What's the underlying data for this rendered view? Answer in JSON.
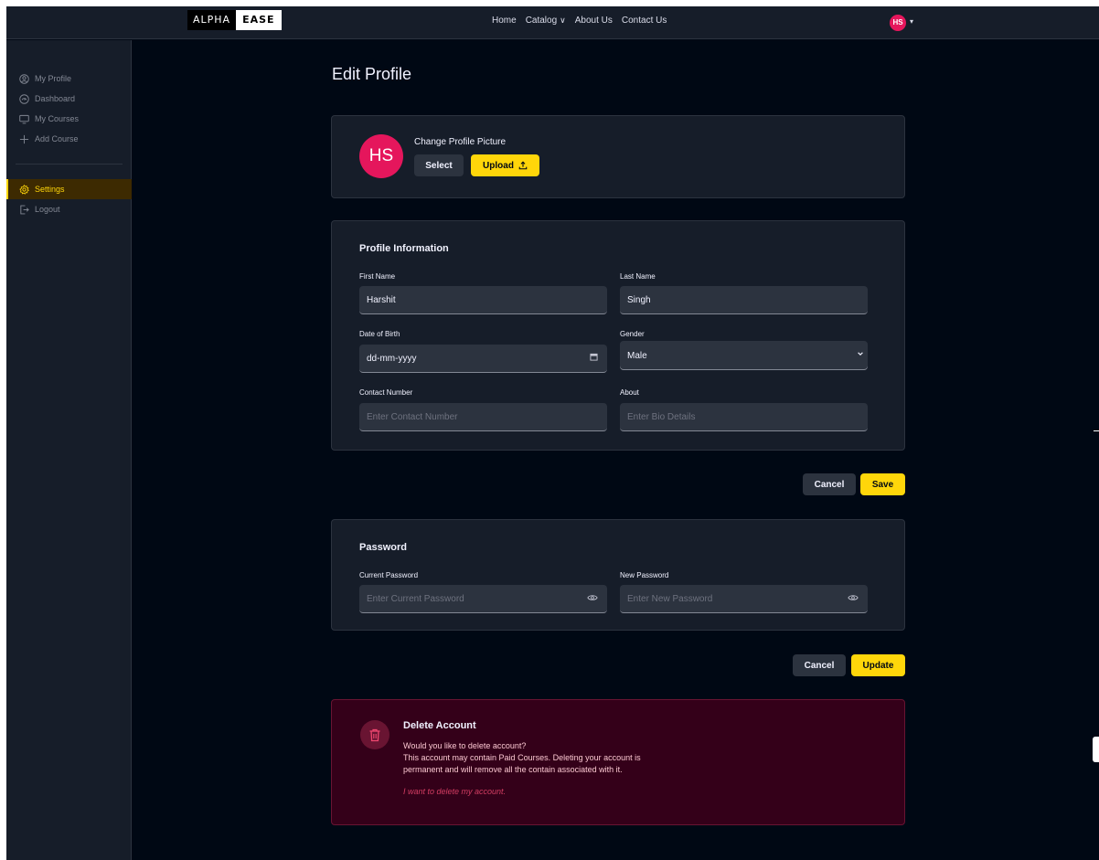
{
  "brand": {
    "part1": "ALPHA",
    "part2": "EASE"
  },
  "nav": {
    "links": [
      "Home",
      "Catalog",
      "About Us",
      "Contact Us"
    ],
    "catalog_chevron": "∨",
    "user_initials": "HS",
    "caret": "▾"
  },
  "sidebar": {
    "items": [
      {
        "label": "My Profile",
        "icon": "user-circle-icon"
      },
      {
        "label": "Dashboard",
        "icon": "dashboard-icon"
      },
      {
        "label": "My Courses",
        "icon": "monitor-icon"
      },
      {
        "label": "Add Course",
        "icon": "plus-icon"
      },
      {
        "label": "Settings",
        "icon": "gear-icon",
        "active": true
      },
      {
        "label": "Logout",
        "icon": "logout-icon"
      }
    ]
  },
  "page": {
    "title": "Edit Profile"
  },
  "picture": {
    "initials": "HS",
    "label": "Change Profile Picture",
    "select_label": "Select",
    "upload_label": "Upload",
    "upload_icon": "upload-icon"
  },
  "profile": {
    "title": "Profile Information",
    "first_name_label": "First Name",
    "first_name_value": "Harshit",
    "last_name_label": "Last Name",
    "last_name_value": "Singh",
    "dob_label": "Date of Birth",
    "dob_value": "dd-mm-yyyy",
    "gender_label": "Gender",
    "gender_value": "Male",
    "contact_label": "Contact Number",
    "contact_placeholder": "Enter Contact Number",
    "about_label": "About",
    "about_placeholder": "Enter Bio Details",
    "cancel_label": "Cancel",
    "save_label": "Save"
  },
  "password": {
    "title": "Password",
    "current_label": "Current Password",
    "current_placeholder": "Enter Current Password",
    "new_label": "New Password",
    "new_placeholder": "Enter New Password",
    "cancel_label": "Cancel",
    "update_label": "Update"
  },
  "delete": {
    "title": "Delete Account",
    "line1": "Would you like to delete account?",
    "line2": "This account may contain Paid Courses. Deleting your account is",
    "line3": "permanent and will remove all the contain associated with it.",
    "link": "I want to delete my account."
  },
  "colors": {
    "accent": "#ffd60a",
    "avatar": "#e5165c",
    "danger_bg": "#340019",
    "danger_link": "#d43d63"
  }
}
